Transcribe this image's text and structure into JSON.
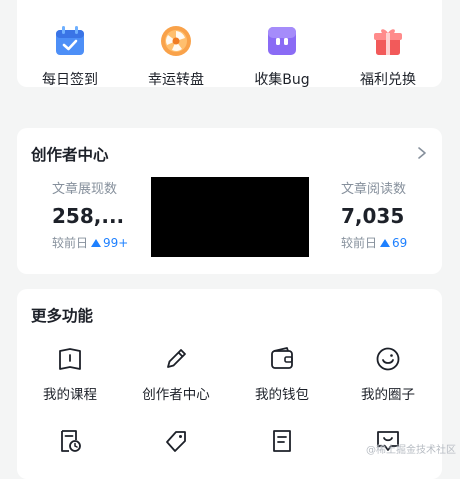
{
  "quick_actions": [
    {
      "label": "每日签到",
      "icon": "calendar-check-icon",
      "color": "#3b82f6"
    },
    {
      "label": "幸运转盘",
      "icon": "lucky-wheel-icon",
      "color": "#f59e42"
    },
    {
      "label": "收集Bug",
      "icon": "bug-box-icon",
      "color": "#7c5cf0"
    },
    {
      "label": "福利兑换",
      "icon": "gift-icon",
      "color": "#ef4444"
    }
  ],
  "creator": {
    "title": "创作者中心",
    "views": {
      "label": "文章展现数",
      "value": "258,...",
      "sub_label": "较前日",
      "delta": "99+"
    },
    "reads": {
      "label": "文章阅读数",
      "value": "7,035",
      "sub_label": "较前日",
      "delta": "69"
    }
  },
  "more": {
    "title": "更多功能",
    "items": [
      {
        "label": "我的课程",
        "icon": "book-icon"
      },
      {
        "label": "创作者中心",
        "icon": "pencil-icon"
      },
      {
        "label": "我的钱包",
        "icon": "wallet-icon"
      },
      {
        "label": "我的圈子",
        "icon": "smile-circle-icon"
      },
      {
        "label": "",
        "icon": "document-clock-icon"
      },
      {
        "label": "",
        "icon": "tag-icon"
      },
      {
        "label": "",
        "icon": "document-list-icon"
      },
      {
        "label": "",
        "icon": "chat-bubble-icon"
      }
    ]
  },
  "watermark": "@稀土掘金技术社区",
  "colors": {
    "accent": "#1e80ff",
    "background": "#f4f5f5",
    "card": "#ffffff",
    "redacted": "#000000"
  }
}
